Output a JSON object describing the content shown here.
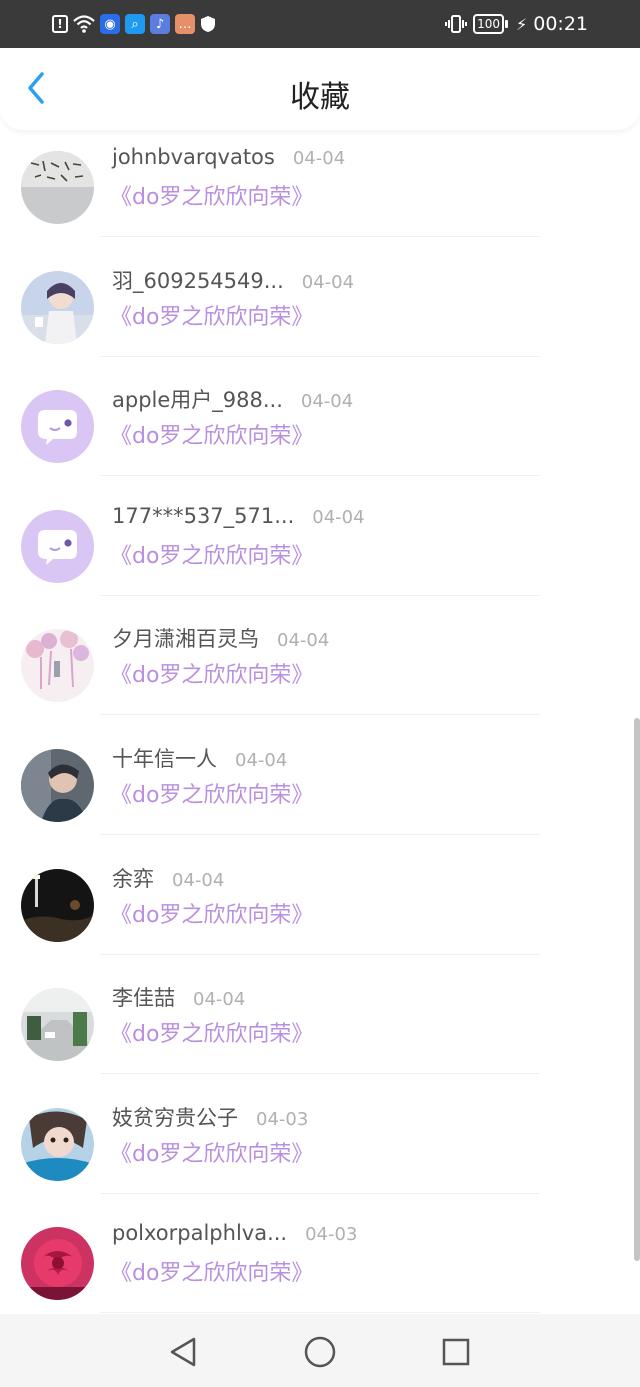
{
  "status_bar": {
    "battery": "100",
    "time": "00:21",
    "icons": [
      "alert-icon",
      "wifi-icon",
      "app-icon",
      "search-app-icon",
      "music-app-icon",
      "message-app-icon",
      "shield-icon",
      "vibrate-icon",
      "battery-icon",
      "charging-icon"
    ]
  },
  "header": {
    "title": "收藏",
    "back_icon": "chevron-left-icon"
  },
  "list": {
    "items": [
      {
        "name": "johnbvarqvatos",
        "date": "04-04",
        "title": "《do罗之欣欣向荣》",
        "avatar": "calligraphy-photo"
      },
      {
        "name": "羽_609254549...",
        "date": "04-04",
        "title": "《do罗之欣欣向荣》",
        "avatar": "anime-boy-photo"
      },
      {
        "name": "apple用户_988...",
        "date": "04-04",
        "title": "《do罗之欣欣向荣》",
        "avatar": "default-chat-avatar"
      },
      {
        "name": "177***537_571...",
        "date": "04-04",
        "title": "《do罗之欣欣向荣》",
        "avatar": "default-chat-avatar"
      },
      {
        "name": "夕月潇湘百灵鸟",
        "date": "04-04",
        "title": "《do罗之欣欣向荣》",
        "avatar": "blossom-photo"
      },
      {
        "name": "十年信一人",
        "date": "04-04",
        "title": "《do罗之欣欣向荣》",
        "avatar": "portrait-photo"
      },
      {
        "name": "余弈",
        "date": "04-04",
        "title": "《do罗之欣欣向荣》",
        "avatar": "night-photo"
      },
      {
        "name": "李佳喆",
        "date": "04-04",
        "title": "《do罗之欣欣向荣》",
        "avatar": "street-photo"
      },
      {
        "name": "妓贫穷贵公子",
        "date": "04-03",
        "title": "《do罗之欣欣向荣》",
        "avatar": "girl-photo"
      },
      {
        "name": "polxorpalphlva...",
        "date": "04-03",
        "title": "《do罗之欣欣向荣》",
        "avatar": "rose-photo"
      }
    ]
  },
  "nav_bar": {
    "buttons": [
      "back-triangle-icon",
      "home-circle-icon",
      "recents-square-icon"
    ]
  },
  "colors": {
    "status_bar_bg": "#3a3a3a",
    "accent_blue": "#2aa0ee",
    "title_purple": "#b98fdf",
    "default_avatar_bg": "#d9c6f4"
  }
}
